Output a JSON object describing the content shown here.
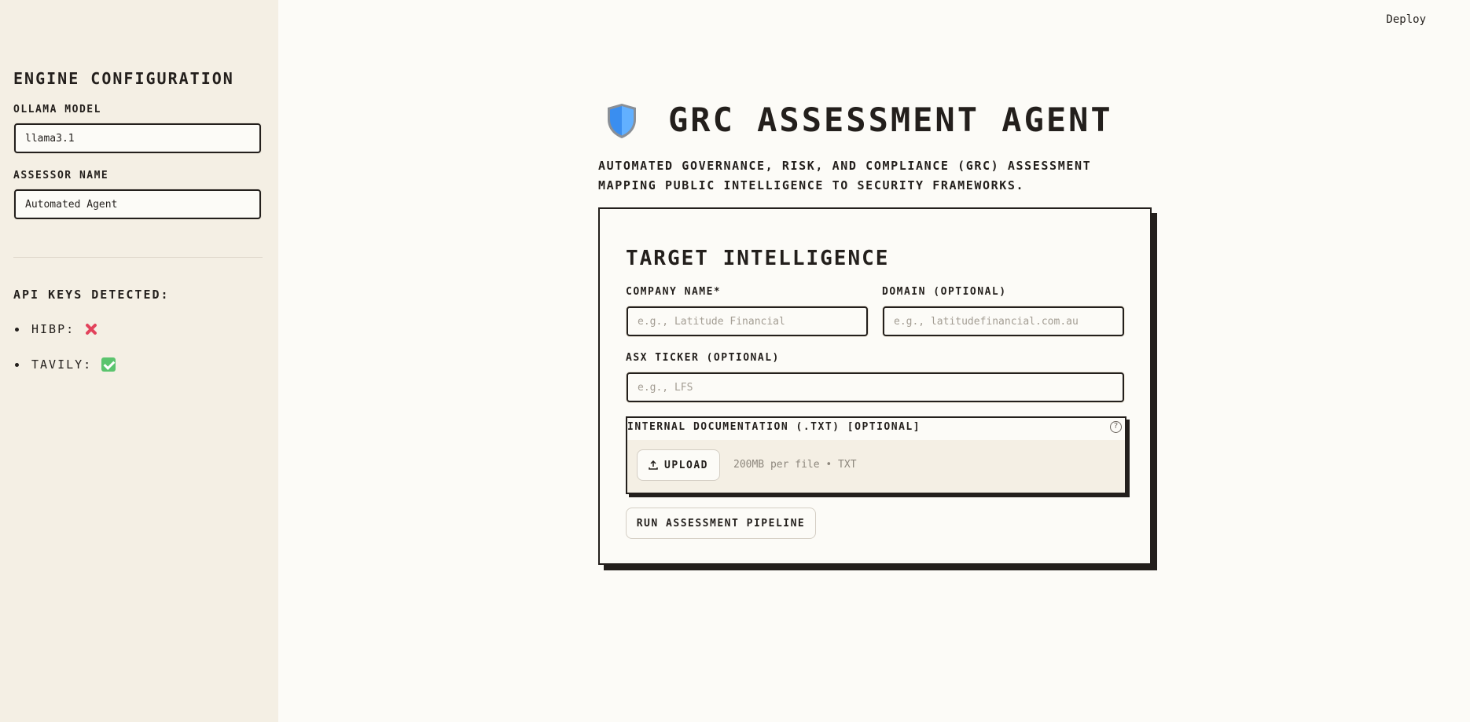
{
  "header": {
    "deploy_label": "Deploy"
  },
  "sidebar": {
    "title": "ENGINE CONFIGURATION",
    "ollama_model_label": "OLLAMA MODEL",
    "ollama_model_value": "llama3.1",
    "assessor_name_label": "ASSESSOR NAME",
    "assessor_name_value": "Automated Agent",
    "api_keys_title": "API KEYS DETECTED:",
    "api_keys": [
      {
        "label": "HIBP:",
        "status": "x-mark-icon",
        "status_color": "#e2435c"
      },
      {
        "label": "TAVILY:",
        "status": "check-mark-icon",
        "status_color": "#5bc46e"
      }
    ]
  },
  "main": {
    "title": "GRC ASSESSMENT AGENT",
    "subtitle_line1": "AUTOMATED GOVERNANCE, RISK, AND COMPLIANCE (GRC) ASSESSMENT",
    "subtitle_line2": "MAPPING PUBLIC INTELLIGENCE TO SECURITY FRAMEWORKS.",
    "card": {
      "title": "TARGET INTELLIGENCE",
      "company_label": "COMPANY NAME*",
      "company_placeholder": "e.g., Latitude Financial",
      "domain_label": "DOMAIN (OPTIONAL)",
      "domain_placeholder": "e.g., latitudefinancial.com.au",
      "ticker_label": "ASX TICKER (OPTIONAL)",
      "ticker_placeholder": "e.g., LFS",
      "upload_label": "INTERNAL DOCUMENTATION (.TXT) [OPTIONAL]",
      "help_glyph": "?",
      "upload_button": "UPLOAD",
      "upload_hint": "200MB per file • TXT",
      "run_button": "RUN ASSESSMENT PIPELINE"
    }
  },
  "colors": {
    "background": "#fcfbf7",
    "sidebar": "#f4efe4",
    "ink": "#231f1c",
    "shield_blue": "#3a8ef0"
  }
}
